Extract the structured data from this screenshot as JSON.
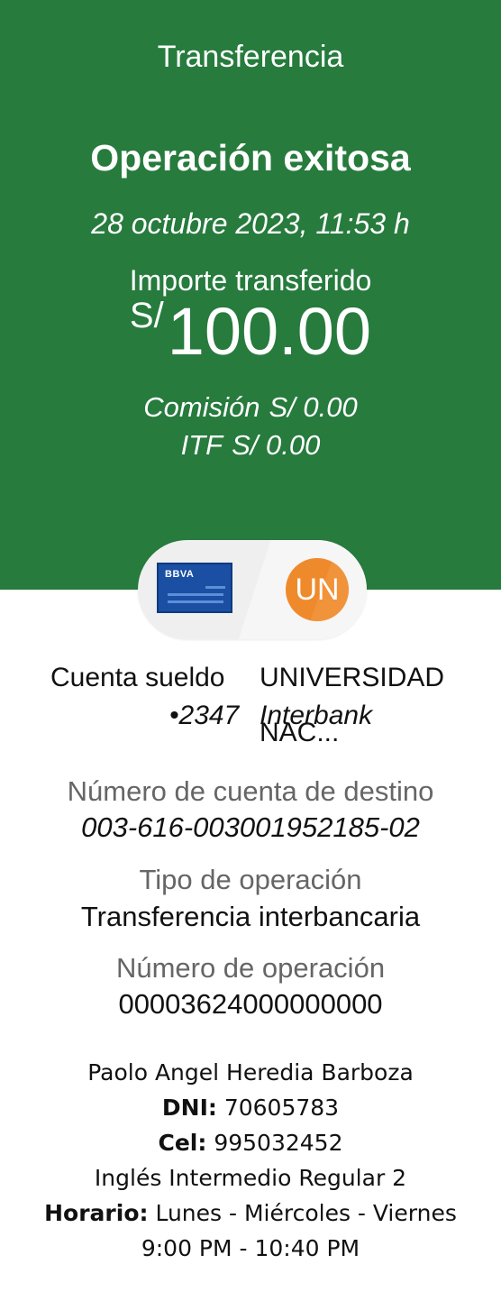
{
  "header": {
    "title": "Transferencia",
    "status": "Operación exitosa",
    "datetime": "28 octubre 2023, 11:53 h",
    "amount_label": "Importe transferido",
    "currency": "S/",
    "amount": "100.00",
    "commission_label": "Comisión",
    "commission_value": "S/ 0.00",
    "itf_label": "ITF",
    "itf_value": "S/ 0.00"
  },
  "transfer": {
    "origin_card_brand": "BBVA",
    "destination_badge": "UN",
    "origin_account_name": "Cuenta sueldo",
    "origin_account_number": "•2347",
    "destination_name": "UNIVERSIDAD",
    "destination_bank": "Interbank",
    "destination_name_overflow": "NAC..."
  },
  "details": {
    "destination_account_label": "Número de cuenta de destino",
    "destination_account_value": "003-616-003001952185-02",
    "operation_type_label": "Tipo de operación",
    "operation_type_value": "Transferencia interbancaria",
    "operation_number_label": "Número de operación",
    "operation_number_value": "00003624000000000"
  },
  "notes": {
    "name": "Paolo Angel Heredia Barboza",
    "dni_label": "DNI:",
    "dni_value": "70605783",
    "cel_label": "Cel:",
    "cel_value": "995032452",
    "course": "Inglés Intermedio Regular 2",
    "schedule_label": "Horario:",
    "schedule_days": "Lunes - Miércoles - Viernes",
    "schedule_time": "9:00 PM - 10:40 PM"
  },
  "colors": {
    "header_bg": "#267b3d",
    "badge_orange": "#ef8a2c",
    "card_blue": "#1a4fa3"
  }
}
